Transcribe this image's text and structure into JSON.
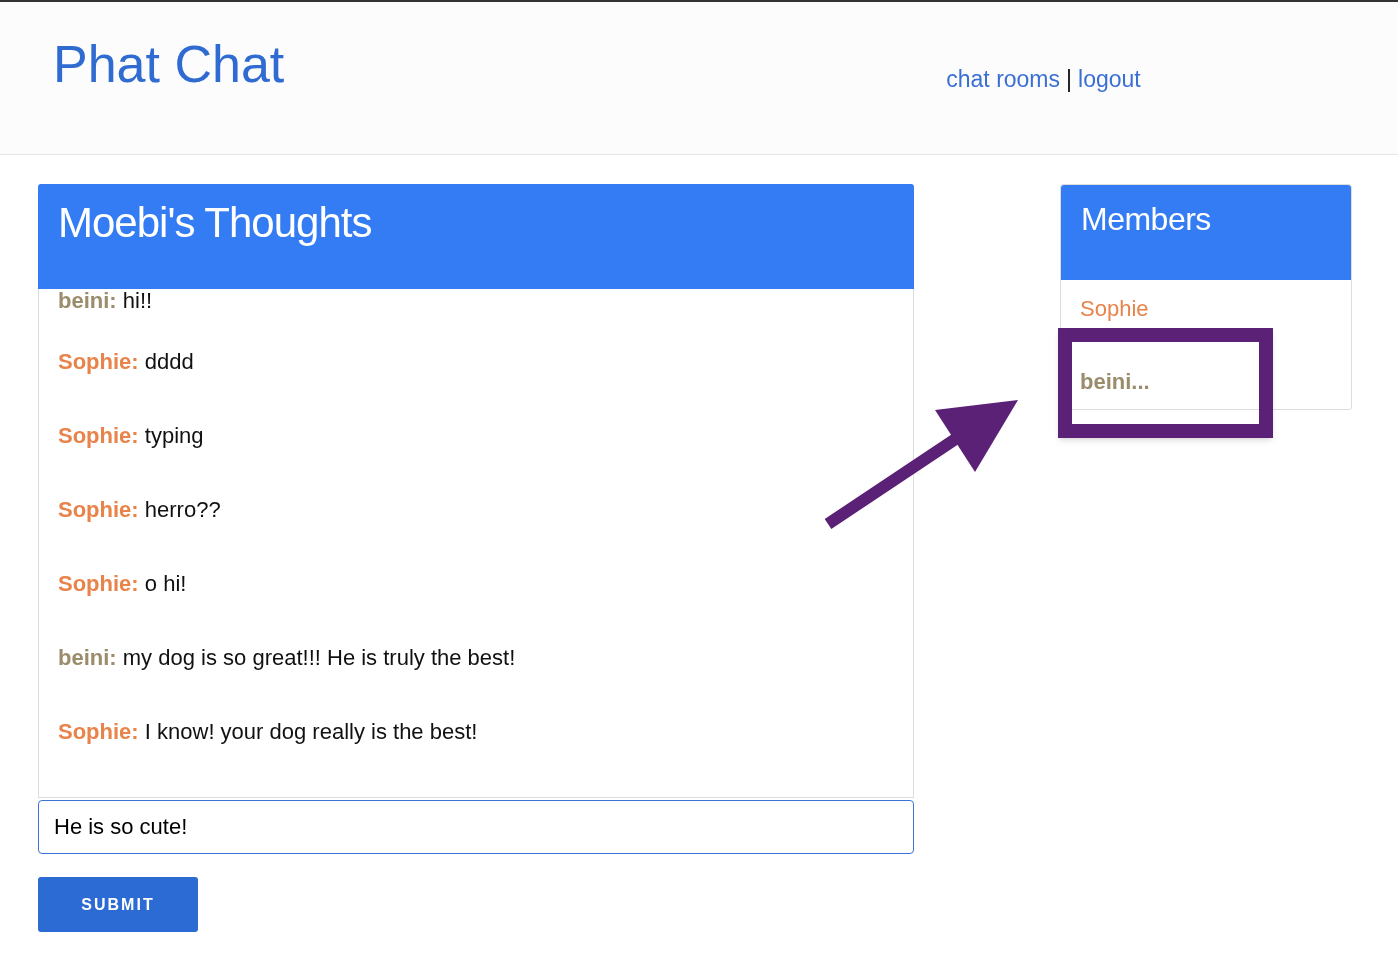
{
  "header": {
    "title": "Phat Chat",
    "links": [
      "chat rooms",
      "logout"
    ],
    "separator": "|"
  },
  "room": {
    "title": "Moebi's Thoughts",
    "messages": [
      {
        "author": "beini:",
        "color": "#9b8c6c",
        "text": "hi!!"
      },
      {
        "author": "Sophie:",
        "color": "#e8834a",
        "text": "dddd"
      },
      {
        "author": "Sophie:",
        "color": "#e8834a",
        "text": "typing"
      },
      {
        "author": "Sophie:",
        "color": "#e8834a",
        "text": "herro??"
      },
      {
        "author": "Sophie:",
        "color": "#e8834a",
        "text": "o hi!"
      },
      {
        "author": "beini:",
        "color": "#9b8c6c",
        "text": "my dog is so great!!! He is truly the best!"
      },
      {
        "author": "Sophie:",
        "color": "#e8834a",
        "text": "I know! your dog really is the best!"
      }
    ],
    "input": {
      "value": "He is so cute!"
    },
    "submit": "SUBMIT"
  },
  "members": {
    "title": "Members",
    "items": [
      {
        "name": "Sophie",
        "color": "#e8834a",
        "kind": "plain"
      },
      {
        "name": "beini...",
        "color": "#9b8c6c",
        "kind": "typing"
      }
    ]
  }
}
